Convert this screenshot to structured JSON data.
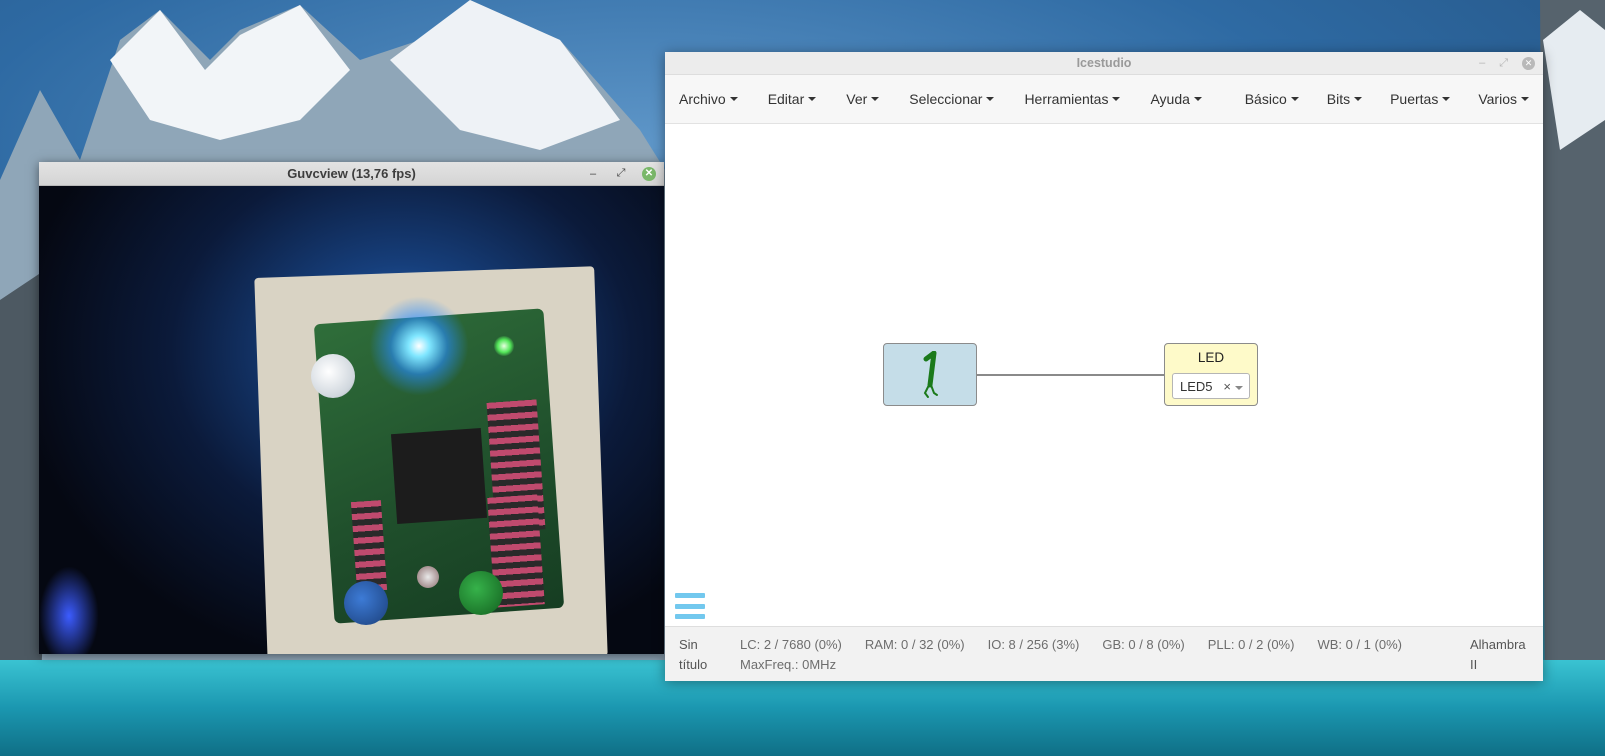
{
  "guvcview": {
    "title": "Guvcview  (13,76 fps)",
    "minimize": "–",
    "maximize": "⤢",
    "close": "✕"
  },
  "icestudio": {
    "title": "Icestudio",
    "window_minimize": "–",
    "window_maximize": "⤢",
    "window_close": "✕",
    "menu_left": [
      "Archivo",
      "Editar",
      "Ver",
      "Seleccionar",
      "Herramientas",
      "Ayuda"
    ],
    "menu_right": [
      "Básico",
      "Bits",
      "Puertas",
      "Varios"
    ],
    "blocks": {
      "constant": {
        "value": "1",
        "color": "#c5dde8"
      },
      "led": {
        "label": "LED",
        "selected": "LED5",
        "clear": "×",
        "color": "#fefac9"
      }
    },
    "status": {
      "project": "Sin título",
      "lc": "LC:  2 / 7680 (0%)",
      "ram": "RAM:  0 / 32 (0%)",
      "io": "IO:  8 / 256 (3%)",
      "gb": "GB:  0 / 8 (0%)",
      "pll": "PLL:  0 / 2 (0%)",
      "wb": "WB:  0 / 1 (0%)",
      "maxfreq": "MaxFreq.:  0MHz",
      "board": "Alhambra II"
    },
    "accent": "#72c8ee"
  }
}
